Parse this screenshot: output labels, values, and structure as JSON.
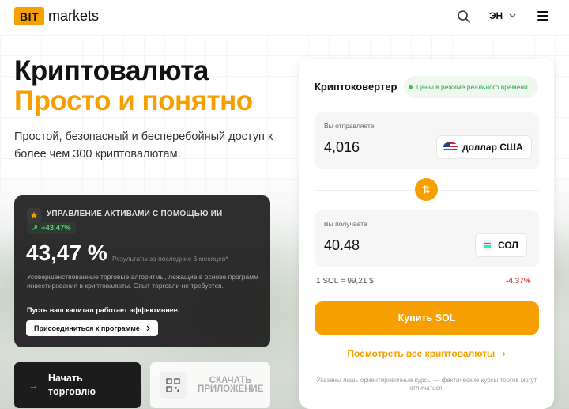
{
  "header": {
    "logo_box": "BIT",
    "logo_text": "markets",
    "lang": "ЭН",
    "icons": [
      "search-icon",
      "chevron-down-icon",
      "menu-icon"
    ]
  },
  "hero": {
    "title_line1": "Криптовалюта",
    "title_line2": "Просто и понятно",
    "subtitle": "Простой, безопасный и бесперебойный доступ к более чем 300 криптовалютам."
  },
  "ai_card": {
    "label": "УПРАВЛЕНИЕ АКТИВАМИ С ПОМОЩЬЮ ИИ",
    "badge": "+43,47%",
    "big_value": "43,47 %",
    "big_note": "Результаты за последние 6 месяцев*",
    "description": "Усовершенствованные торговые алгоритмы, лежащие в основе программ инвестирования в криптовалюты. Опыт торговли не требуется.",
    "cta_text": "Пусть ваш капитал работает эффективнее.",
    "join_label": "Присоединиться к программе"
  },
  "buttons": {
    "start_line1": "Начать",
    "start_line2": "торговлю",
    "app_line1": "СКАЧАТЬ",
    "app_line2": "ПРИЛОЖЕНИЕ"
  },
  "converter": {
    "title": "Криптоковертер",
    "live_label": "Цены в режиме реального времени",
    "send_label": "Вы отправляете",
    "send_value": "4,016",
    "send_currency": "доллар США",
    "receive_label": "Вы получаете",
    "receive_value": "40.48",
    "receive_currency": "СОЛ",
    "rate": "1 SOL = 99,21 $",
    "change": "-4,37%",
    "buy_label": "Купить SOL",
    "view_all": "Посмотреть все криптовалюты",
    "disclaimer": "Указаны лишь ориентировочные курсы — фактические курсы торгов могут отличаться."
  },
  "colors": {
    "accent": "#f5a000",
    "negative": "#e04747",
    "positive": "#2ea84a"
  }
}
